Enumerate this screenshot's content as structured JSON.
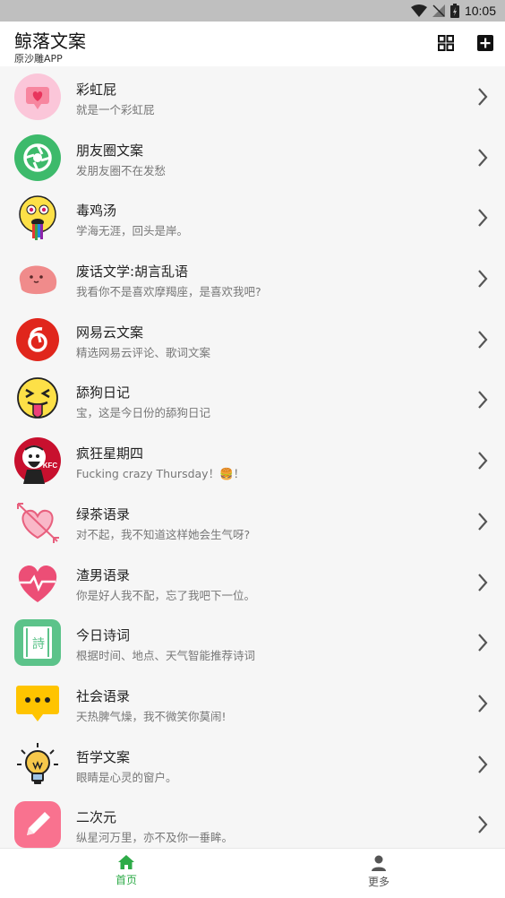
{
  "status_bar": {
    "time": "10:05"
  },
  "app_bar": {
    "title": "鲸落文案",
    "subtitle": "原沙雕APP"
  },
  "items": [
    {
      "title": "彩虹屁",
      "subtitle": "就是一个彩虹屁"
    },
    {
      "title": "朋友圈文案",
      "subtitle": "发朋友圈不在发愁"
    },
    {
      "title": "毒鸡汤",
      "subtitle": "学海无涯，回头是岸。"
    },
    {
      "title": "废话文学:胡言乱语",
      "subtitle": "我看你不是喜欢摩羯座，是喜欢我吧?"
    },
    {
      "title": "网易云文案",
      "subtitle": "精选网易云评论、歌词文案"
    },
    {
      "title": "舔狗日记",
      "subtitle": "宝，这是今日份的舔狗日记"
    },
    {
      "title": "疯狂星期四",
      "subtitle": "Fucking crazy Thursday！🍔！"
    },
    {
      "title": "绿茶语录",
      "subtitle": "对不起，我不知道这样她会生气呀?"
    },
    {
      "title": "渣男语录",
      "subtitle": "你是好人我不配，忘了我吧下一位。"
    },
    {
      "title": "今日诗词",
      "subtitle": "根据时间、地点、天气智能推荐诗词",
      "icon_text": "詩"
    },
    {
      "title": "社会语录",
      "subtitle": "天热脾气燥，我不微笑你莫闹!"
    },
    {
      "title": "哲学文案",
      "subtitle": "眼睛是心灵的窗户。"
    },
    {
      "title": "二次元",
      "subtitle": "纵星河万里，亦不及你一垂眸。"
    }
  ],
  "bottom_nav": {
    "home": "首页",
    "more": "更多"
  },
  "colors": {
    "accent": "#2eab48",
    "kfc_text": "KFC"
  }
}
